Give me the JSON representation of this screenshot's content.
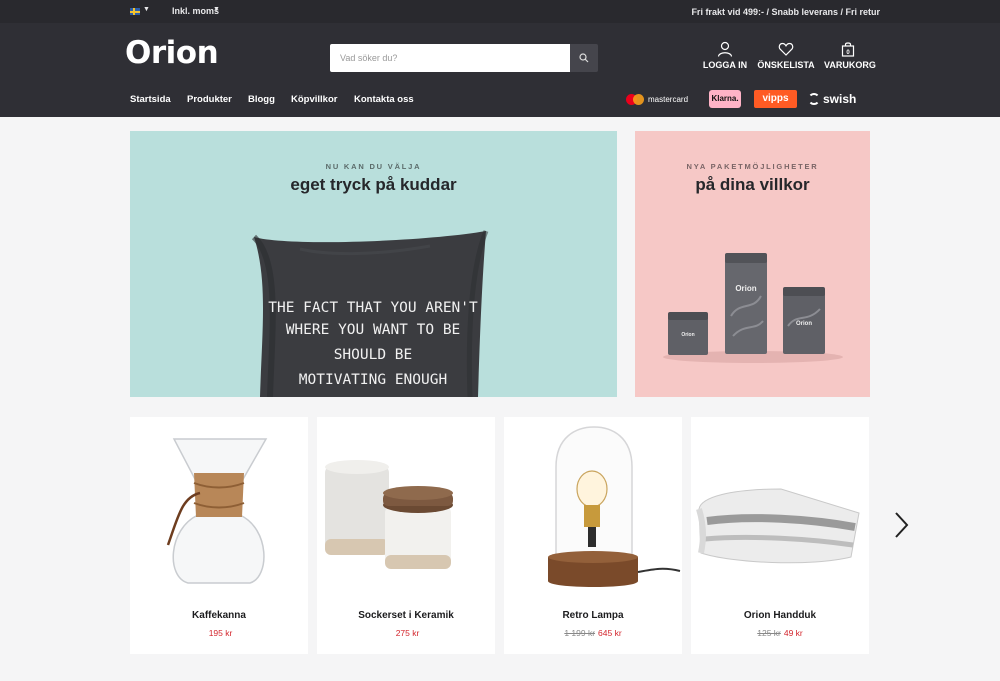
{
  "topbar": {
    "flag_icon": "sweden-flag-icon",
    "vat_label": "Inkl. moms",
    "usp": "Fri frakt vid 499:- / Snabb leverans / Fri retur"
  },
  "header": {
    "logo": "Orion",
    "search_placeholder": "Vad söker du?",
    "actions": [
      {
        "label": "LOGGA IN",
        "icon": "user-icon"
      },
      {
        "label": "ÖNSKELISTA",
        "icon": "heart-icon"
      },
      {
        "label": "VARUKORG",
        "icon": "bag-icon",
        "count": "0"
      }
    ]
  },
  "nav": [
    "Startsida",
    "Produkter",
    "Blogg",
    "Köpvillkor",
    "Kontakta oss"
  ],
  "payments": {
    "mastercard": "mastercard",
    "klarna": "Klarna.",
    "vipps": "vipps",
    "swish": "swish"
  },
  "banners": [
    {
      "kicker": "NU KAN DU VÄLJA",
      "title": "eget tryck på kuddar",
      "pillow_lines": [
        "THE FACT THAT YOU AREN'T",
        "WHERE YOU WANT TO BE",
        "SHOULD BE",
        "MOTIVATING ENOUGH"
      ]
    },
    {
      "kicker": "NYA PAKETMÖJLIGHETER",
      "title": "på dina villkor",
      "tin_label": "Orion"
    }
  ],
  "products": [
    {
      "name": "Kaffekanna",
      "old_price": "",
      "price": "195 kr"
    },
    {
      "name": "Sockerset i Keramik",
      "old_price": "",
      "price": "275 kr"
    },
    {
      "name": "Retro Lampa",
      "old_price": "1 199 kr",
      "price": "645 kr"
    },
    {
      "name": "Orion Handduk",
      "old_price": "125 kr",
      "price": "49 kr"
    }
  ],
  "colors": {
    "topbar": "#29292e",
    "header": "#2f2f35",
    "banner1": "#b9dfdc",
    "banner2": "#f6c8c6",
    "price": "#d3262d"
  }
}
